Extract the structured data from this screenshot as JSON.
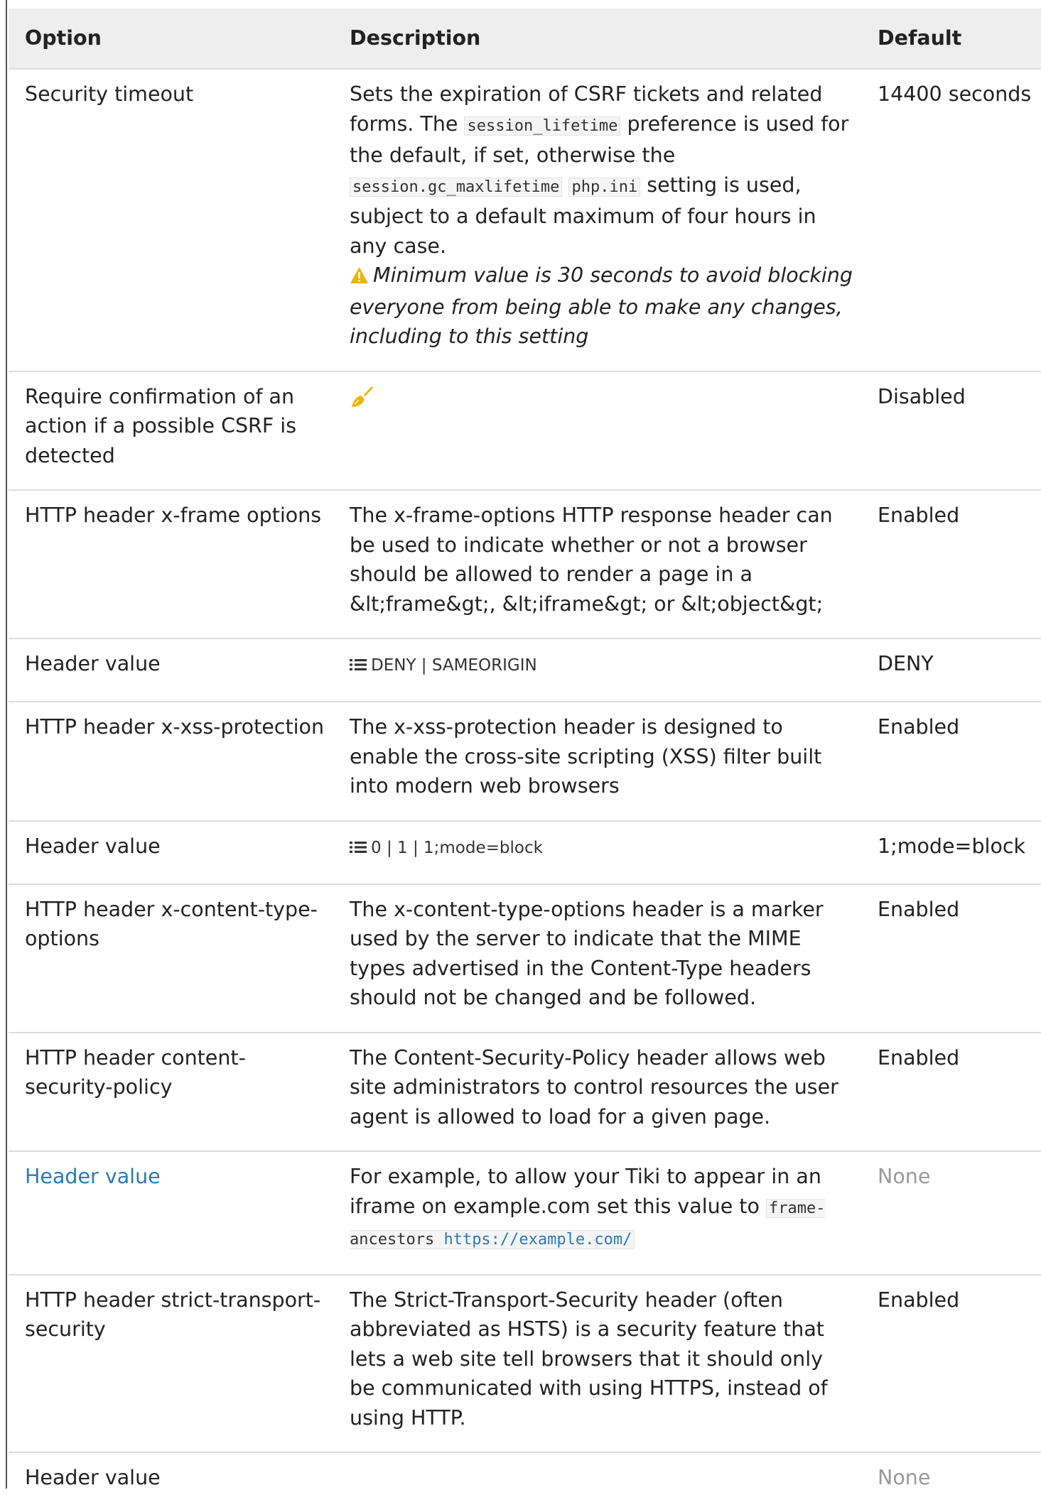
{
  "headers": {
    "option": "Option",
    "description": "Description",
    "default": "Default"
  },
  "rows": [
    {
      "option": "Security timeout",
      "description": {
        "part1": "Sets the expiration of CSRF tickets and related forms. The ",
        "code1": "session_lifetime",
        "part2": " preference is used for the default, if set, otherwise the ",
        "code2": "session.gc_maxlifetime",
        "part3": " ",
        "code3": "php.ini",
        "part4": " setting is used, subject to a default maximum of four hours in any case.",
        "warning": "Minimum value is 30 seconds to avoid blocking everyone from being able to make any changes, including to this setting"
      },
      "default": "14400 seconds"
    },
    {
      "option": "Require confirmation of an action if a possible CSRF is detected",
      "description_icon": "brush-icon",
      "default": "Disabled"
    },
    {
      "option": "HTTP header x-frame options",
      "description": "The x-frame-options HTTP response header can be used to indicate whether or not a browser should be allowed to render a page in a &lt;frame&gt;, &lt;iframe&gt; or &lt;object&gt;",
      "default": "Enabled"
    },
    {
      "option": "Header value",
      "options_icon": "list-icon",
      "options": "DENY | SAMEORIGIN",
      "default": "DENY"
    },
    {
      "option": "HTTP header x-xss-protection",
      "description": "The x-xss-protection header is designed to enable the cross-site scripting (XSS) filter built into modern web browsers",
      "default": "Enabled"
    },
    {
      "option": "Header value",
      "options_icon": "list-icon",
      "options": "0 | 1 | 1;mode=block",
      "default": "1;mode=block"
    },
    {
      "option": "HTTP header x-content-type-options",
      "description": "The x-content-type-options header is a marker used by the server to indicate that the MIME types advertised in the Content-Type headers should not be changed and be followed.",
      "default": "Enabled"
    },
    {
      "option": "HTTP header content-security-policy",
      "description": "The Content-Security-Policy header allows web site administrators to control resources the user agent is allowed to load for a given page.",
      "default": "Enabled"
    },
    {
      "option": "Header value",
      "description": {
        "part1": "For example, to allow your Tiki to appear in an iframe on example.com set this value to ",
        "code_text": "frame-ancestors ",
        "code_url": "https://example.com/"
      },
      "default": "None"
    },
    {
      "option": "HTTP header strict-transport-security",
      "description": "The Strict-Transport-Security header (often abbreviated as HSTS) is a security feature that lets a web site tell browsers that it should only be communicated with using HTTPS, instead of using HTTP.",
      "default": "Enabled"
    },
    {
      "option": "Header value",
      "description": "",
      "default": "None"
    }
  ],
  "colors": {
    "link": "#2a7ab8",
    "muted": "#999999",
    "header_bg": "#eeeeee",
    "warning": "#f0b400",
    "brush": "#f0b400"
  }
}
